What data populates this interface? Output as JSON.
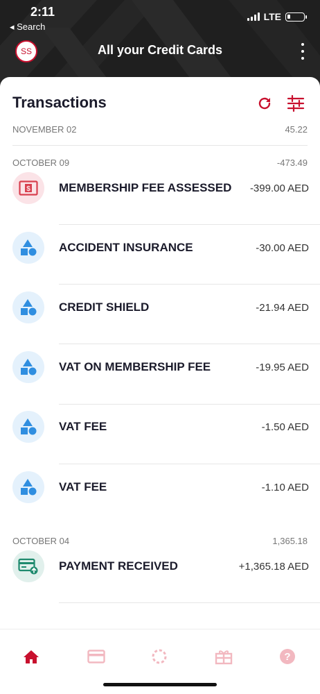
{
  "status_bar": {
    "time": "2:11",
    "back_label": "◂ Search",
    "network": "LTE"
  },
  "header": {
    "avatar_initials": "SS",
    "title": "All your Credit Cards"
  },
  "transactions": {
    "title": "Transactions",
    "groups": [
      {
        "date": "NOVEMBER 02",
        "total": "45.22",
        "items": []
      },
      {
        "date": "OCTOBER 09",
        "total": "-473.49",
        "items": [
          {
            "name": "MEMBERSHIP FEE ASSESSED",
            "amount": "-399.00 AED",
            "icon": "fee-icon"
          },
          {
            "name": "ACCIDENT INSURANCE",
            "amount": "-30.00 AED",
            "icon": "shapes-icon"
          },
          {
            "name": "CREDIT SHIELD",
            "amount": "-21.94 AED",
            "icon": "shapes-icon"
          },
          {
            "name": "VAT ON MEMBERSHIP FEE",
            "amount": "-19.95 AED",
            "icon": "shapes-icon"
          },
          {
            "name": "VAT FEE",
            "amount": "-1.50 AED",
            "icon": "shapes-icon"
          },
          {
            "name": "VAT FEE",
            "amount": "-1.10 AED",
            "icon": "shapes-icon"
          }
        ]
      },
      {
        "date": "OCTOBER 04",
        "total": "1,365.18",
        "items": [
          {
            "name": "PAYMENT RECEIVED",
            "amount": "+1,365.18 AED",
            "icon": "payment-icon"
          }
        ]
      }
    ]
  },
  "bottom_nav": {
    "items": [
      "home-icon",
      "card-icon",
      "spinner-icon",
      "gift-icon",
      "help-icon"
    ],
    "active": "home-icon"
  },
  "colors": {
    "brand_red": "#c8102e",
    "header_bg": "#1f1f1f",
    "category_blue": "#2f8ee0",
    "category_blue_bg": "#e4f1fc",
    "fee_pink_bg": "#fbe3e7",
    "payment_green": "#1f8a6e",
    "payment_green_bg": "#e1f0ec"
  }
}
